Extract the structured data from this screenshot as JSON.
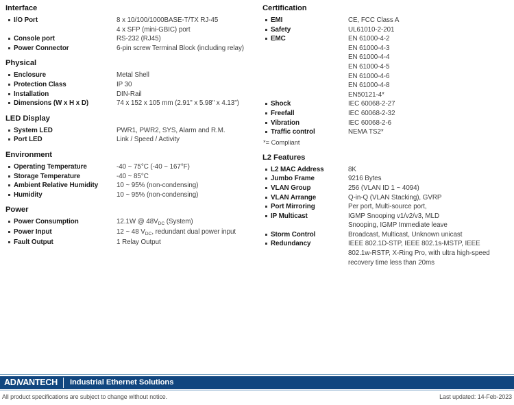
{
  "colors": {
    "footer_bar": "#11467f",
    "footer_rule": "#7ea6c4",
    "label_text": "#1a1a1a",
    "value_text": "#3c3c3c"
  },
  "left_column": [
    {
      "title": "Interface",
      "rows": [
        {
          "label": "I/O Port",
          "values": [
            "8 x 10/100/1000BASE-T/TX RJ-45",
            "4 x SFP (mini-GBIC) port"
          ]
        },
        {
          "label": "Console port",
          "values": [
            "RS-232 (RJ45)"
          ]
        },
        {
          "label": "Power Connector",
          "values": [
            "6-pin screw Terminal Block (including relay)"
          ]
        }
      ]
    },
    {
      "title": "Physical",
      "rows": [
        {
          "label": "Enclosure",
          "values": [
            "Metal Shell"
          ]
        },
        {
          "label": "Protection Class",
          "values": [
            "IP 30"
          ]
        },
        {
          "label": "Installation",
          "values": [
            "DIN-Rail"
          ]
        },
        {
          "label": "Dimensions (W x H x D)",
          "values": [
            "74 x 152 x 105 mm (2.91\" x 5.98\" x 4.13\")"
          ]
        }
      ]
    },
    {
      "title": "LED Display",
      "rows": [
        {
          "label": "System LED",
          "values": [
            "PWR1, PWR2, SYS, Alarm and R.M."
          ]
        },
        {
          "label": "Port LED",
          "values": [
            "Link / Speed / Activity"
          ]
        }
      ]
    },
    {
      "title": "Environment",
      "rows": [
        {
          "label": "Operating Temperature",
          "values": [
            "-40 ~ 75°C (-40 ~ 167°F)"
          ]
        },
        {
          "label": "Storage Temperature",
          "values": [
            "-40 ~ 85°C"
          ]
        },
        {
          "label": "Ambient Relative Humidity",
          "values": [
            "10 ~ 95% (non-condensing)"
          ]
        },
        {
          "label": "Humidity",
          "values": [
            "10 ~ 95% (non-condensing)"
          ]
        }
      ]
    },
    {
      "title": "Power",
      "rows": [
        {
          "label": "Power Consumption",
          "values_html": [
            "12.1W @ 48V<sub>DC</sub> (System)"
          ]
        },
        {
          "label": "Power Input",
          "values_html": [
            "12 ~ 48 V<sub>DC</sub>, redundant dual power input"
          ]
        },
        {
          "label": "Fault Output",
          "values": [
            "1 Relay Output"
          ]
        }
      ]
    }
  ],
  "right_column": [
    {
      "title": "Certification",
      "rows": [
        {
          "label": "EMI",
          "values": [
            "CE, FCC Class A"
          ]
        },
        {
          "label": "Safety",
          "values": [
            "UL61010-2-201"
          ]
        },
        {
          "label": "EMC",
          "values": [
            "EN 61000-4-2",
            "EN 61000-4-3",
            "EN 61000-4-4",
            "EN 61000-4-5",
            "EN 61000-4-6",
            "EN 61000-4-8",
            "EN50121-4*"
          ]
        },
        {
          "label": "Shock",
          "values": [
            "IEC 60068-2-27"
          ]
        },
        {
          "label": "Freefall",
          "values": [
            "IEC 60068-2-32"
          ]
        },
        {
          "label": "Vibration",
          "values": [
            "IEC 60068-2-6"
          ]
        },
        {
          "label": "Traffic control",
          "values": [
            "NEMA TS2*"
          ]
        }
      ],
      "footnote": "*= Compliant"
    },
    {
      "title": "L2 Features",
      "rows": [
        {
          "label": "L2 MAC Address",
          "values": [
            "8K"
          ]
        },
        {
          "label": "Jumbo Frame",
          "values": [
            "9216 Bytes"
          ]
        },
        {
          "label": "VLAN Group",
          "values": [
            "256 (VLAN ID 1 ~ 4094)"
          ]
        },
        {
          "label": "VLAN Arrange",
          "values": [
            "Q-in-Q (VLAN Stacking), GVRP"
          ]
        },
        {
          "label": "Port Mirroring",
          "values": [
            "Per port, Multi-source port,"
          ]
        },
        {
          "label": "IP Multicast",
          "values": [
            "IGMP Snooping v1/v2/v3, MLD",
            "Snooping, IGMP Immediate leave"
          ]
        },
        {
          "label": "Storm Control",
          "values": [
            "Broadcast, Multicast, Unknown unicast"
          ]
        },
        {
          "label": "Redundancy",
          "values": [
            "IEEE 802.1D-STP, IEEE 802.1s-MSTP, IEEE",
            "802.1w-RSTP, X-Ring Pro, with ultra high-speed",
            "recovery time less than 20ms"
          ]
        }
      ]
    }
  ],
  "footer": {
    "brand": "ADVANTECH",
    "tagline": "Industrial Ethernet Solutions",
    "disclaimer": "All product specifications are subject to change without notice.",
    "updated": "Last updated: 14-Feb-2023"
  }
}
